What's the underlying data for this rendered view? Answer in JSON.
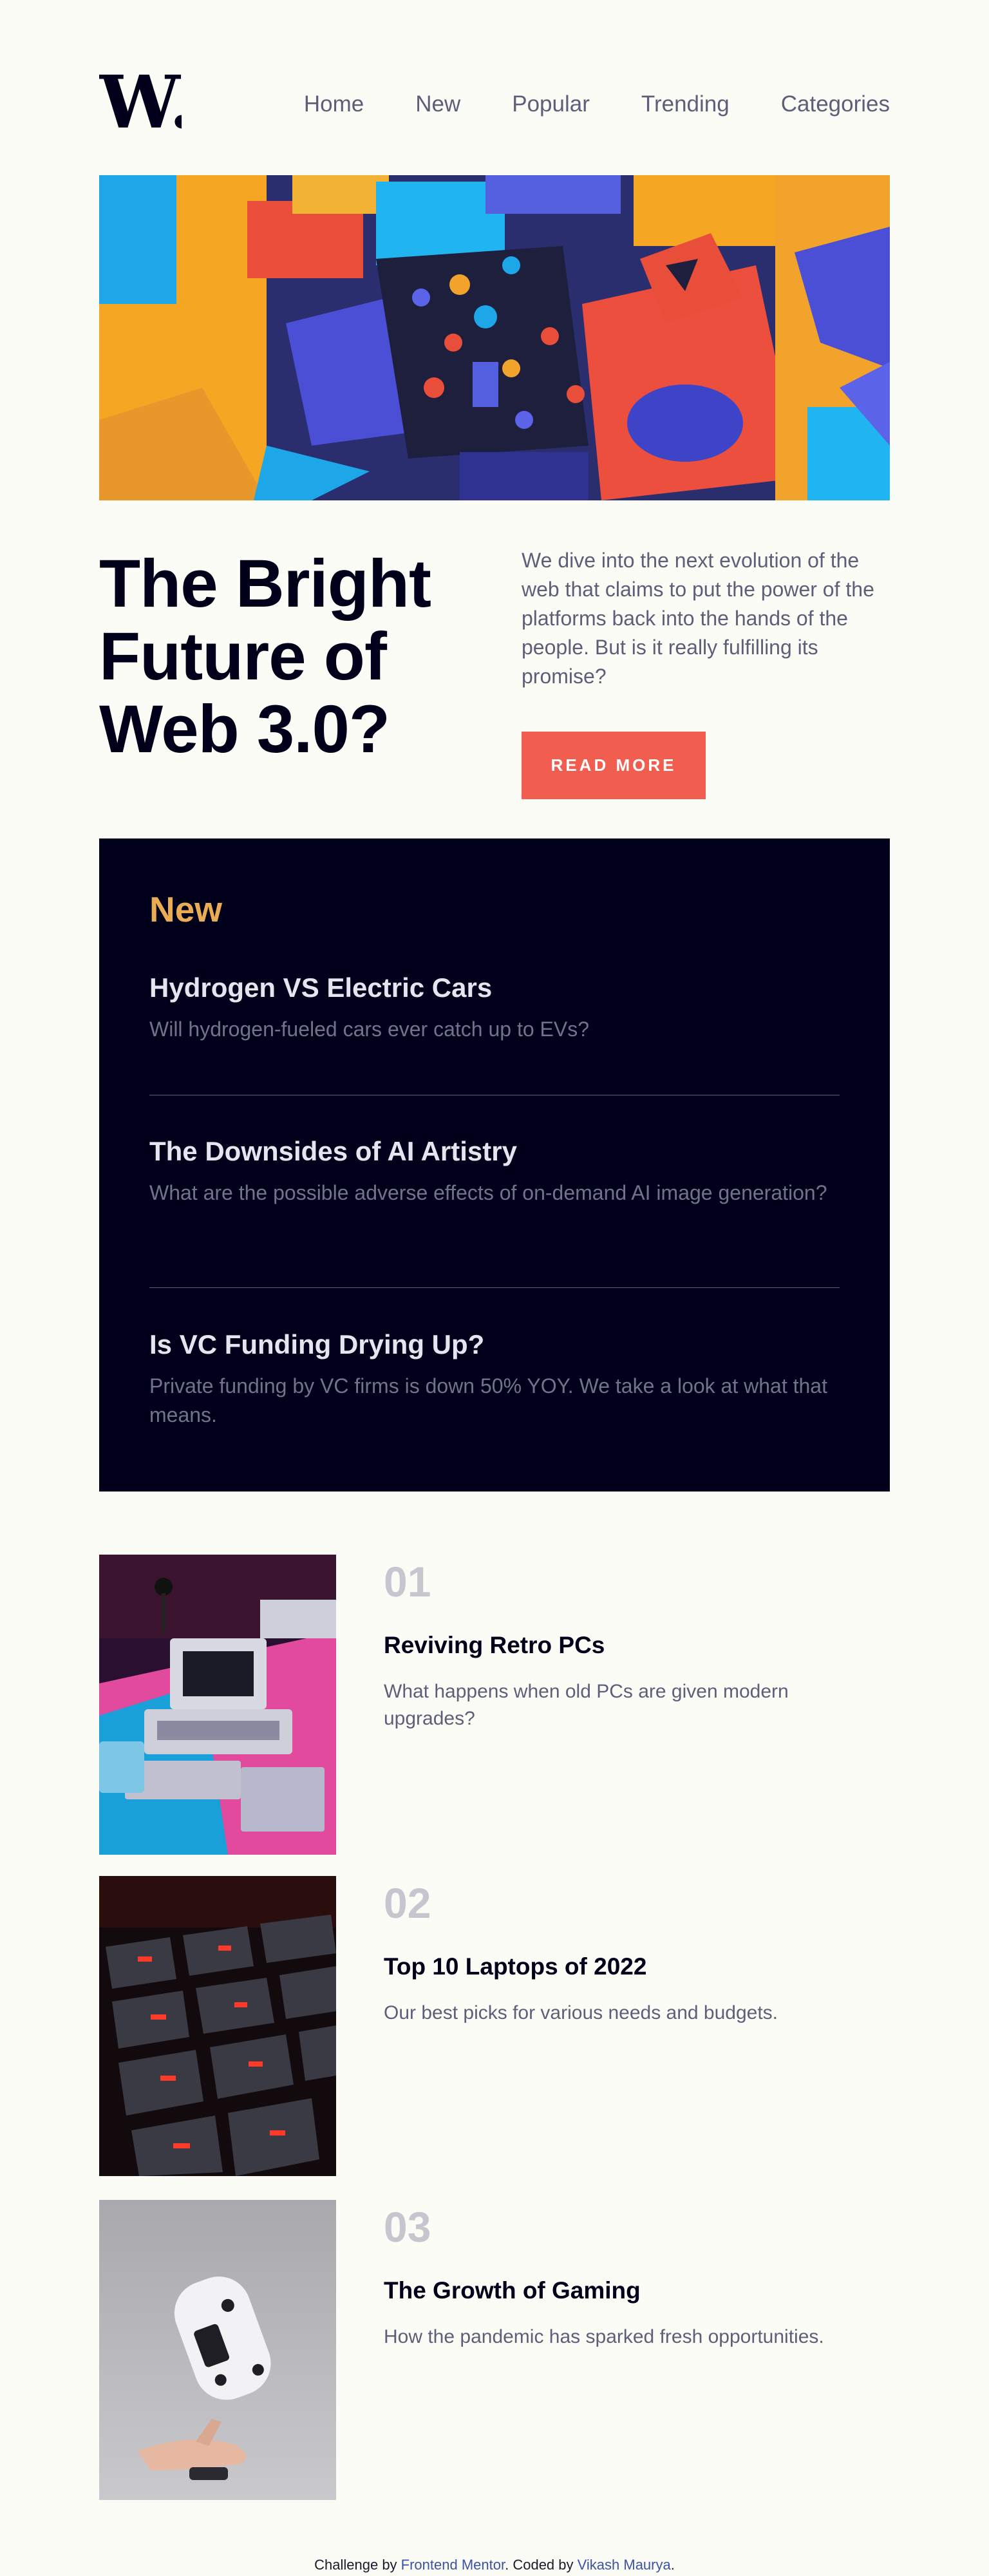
{
  "header": {
    "logo_text": "W.",
    "nav": [
      "Home",
      "New",
      "Popular",
      "Trending",
      "Categories"
    ]
  },
  "hero": {
    "title_lines": [
      "The Bright",
      "Future of",
      "Web 3.0?"
    ],
    "description": "We dive into the next evolution of the web that claims to put the power of the platforms back into the hands of the people. But is it really fulfilling its promise?",
    "button": "READ MORE"
  },
  "new_section": {
    "title": "New",
    "items": [
      {
        "title": "Hydrogen VS Electric Cars",
        "desc": "Will hydrogen-fueled cars ever catch up to EVs?"
      },
      {
        "title": "The Downsides of AI Artistry",
        "desc": "What are the possible adverse effects of on-demand AI image generation?"
      },
      {
        "title": "Is VC Funding Drying Up?",
        "desc": "Private funding by VC firms is down 50% YOY. We take a look at what that means."
      }
    ]
  },
  "articles": [
    {
      "num": "01",
      "title": "Reviving Retro PCs",
      "desc": "What happens when old PCs are given modern upgrades?",
      "image": "retro-pc-image"
    },
    {
      "num": "02",
      "title": "Top 10 Laptops of 2022",
      "desc": "Our best picks for various needs and budgets.",
      "image": "laptop-keyboard-image"
    },
    {
      "num": "03",
      "title": "The Growth of Gaming",
      "desc": "How the pandemic has sparked fresh opportunities.",
      "image": "gamepad-image"
    }
  ],
  "footer": {
    "prefix": "Challenge by ",
    "challenge_link": "Frontend Mentor",
    "middle": ". Coded by ",
    "author_link": "Vikash Maurya",
    "suffix": "."
  },
  "colors": {
    "background": "#fcfcf7",
    "accent_red": "#f15e50",
    "accent_orange": "#e9ab53",
    "dark_navy": "#00001a",
    "grayish_blue": "#5d5f79"
  }
}
